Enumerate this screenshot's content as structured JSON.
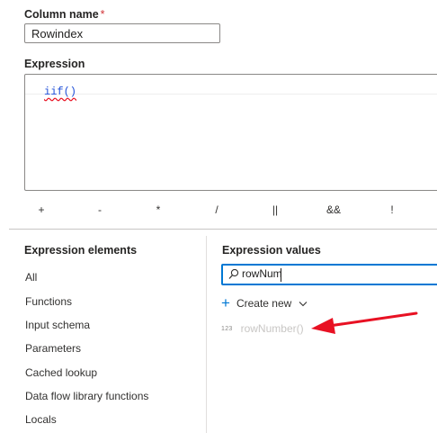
{
  "column_name": {
    "label": "Column name",
    "required_mark": "*",
    "value": "Rowindex"
  },
  "expression": {
    "label": "Expression",
    "code": "iif()"
  },
  "operators": [
    "+",
    "-",
    "*",
    "/",
    "||",
    "&&",
    "!"
  ],
  "elements_panel": {
    "title": "Expression elements",
    "items": [
      "All",
      "Functions",
      "Input schema",
      "Parameters",
      "Cached lookup",
      "Data flow library functions",
      "Locals"
    ]
  },
  "values_panel": {
    "title": "Expression values",
    "search_value": "rowNum",
    "create_new_label": "Create new",
    "results": [
      {
        "type": "123",
        "name": "rowNumber()"
      }
    ]
  },
  "colors": {
    "accent": "#0078d4",
    "annotation_arrow": "#e81123",
    "required": "#d13438"
  },
  "icons": [
    "search-icon",
    "plus-icon",
    "chevron-down-icon",
    "annotation-arrow"
  ]
}
